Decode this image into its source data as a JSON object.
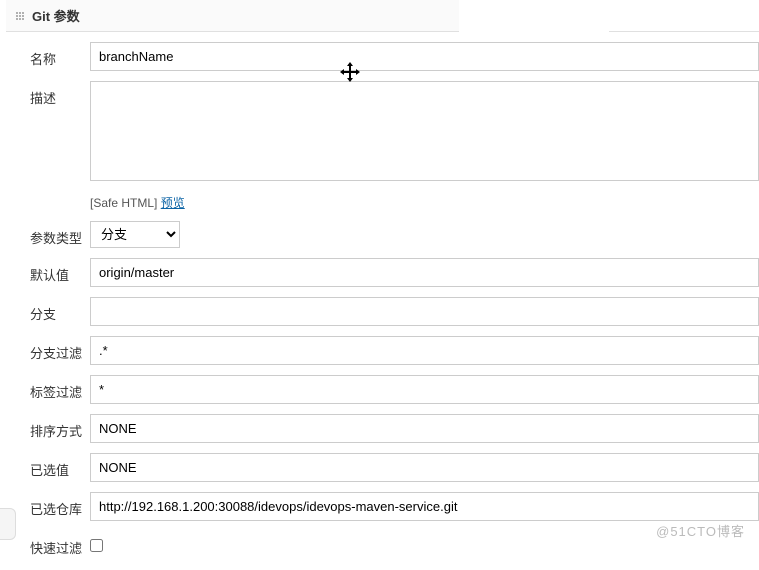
{
  "section": {
    "title": "Git 参数"
  },
  "fields": {
    "name": {
      "label": "名称",
      "value": "branchName"
    },
    "description": {
      "label": "描述",
      "value": ""
    },
    "safeHtml": {
      "prefix": "[Safe HTML]",
      "previewLink": "预览"
    },
    "paramType": {
      "label": "参数类型",
      "selected": "分支",
      "options": [
        "分支"
      ]
    },
    "defaultValue": {
      "label": "默认值",
      "value": "origin/master"
    },
    "branch": {
      "label": "分支",
      "value": ""
    },
    "branchFilter": {
      "label": "分支过滤",
      "value": ".*"
    },
    "tagFilter": {
      "label": "标签过滤",
      "value": "*"
    },
    "sortMode": {
      "label": "排序方式",
      "value": "NONE"
    },
    "selectedValue": {
      "label": "已选值",
      "value": "NONE"
    },
    "selectedRepo": {
      "label": "已选仓库",
      "value": "http://192.168.1.200:30088/idevops/idevops-maven-service.git"
    },
    "quickFilter": {
      "label": "快速过滤",
      "checked": false
    }
  },
  "watermark": "@51CTO博客"
}
